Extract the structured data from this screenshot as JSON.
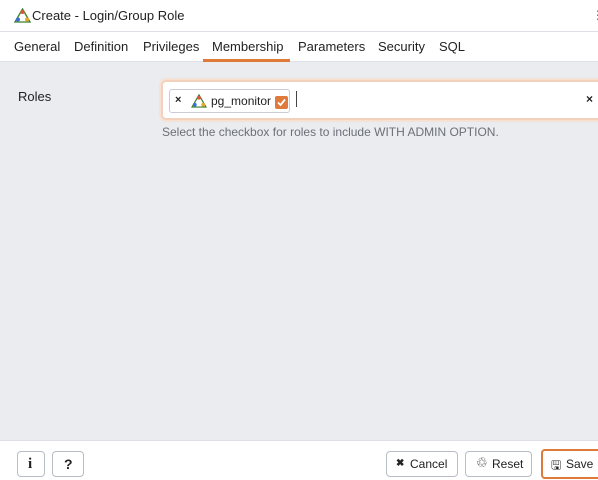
{
  "window": {
    "title": "Create - Login/Group Role",
    "title_icon": "login-group-role-icon",
    "overflow_glyph": "⋮"
  },
  "tabs": [
    {
      "label": "General"
    },
    {
      "label": "Definition"
    },
    {
      "label": "Privileges"
    },
    {
      "label": "Membership",
      "active": true
    },
    {
      "label": "Parameters"
    },
    {
      "label": "Security"
    },
    {
      "label": "SQL"
    }
  ],
  "membership": {
    "roles_label": "Roles",
    "selected_roles": [
      {
        "name": "pg_monitor",
        "admin_option": true,
        "remove_glyph": "×",
        "icon": "role-icon"
      }
    ],
    "clear_glyph": "×",
    "help_text": "Select the checkbox for roles to include WITH ADMIN OPTION."
  },
  "footer": {
    "info_glyph": "i",
    "help_glyph": "?",
    "cancel_glyph": "✖",
    "cancel_label": "Cancel",
    "reset_glyph": "♲",
    "reset_label": "Reset",
    "save_glyph": "🖫",
    "save_label": "Save"
  },
  "colors": {
    "accent": "#e07a3a",
    "content_background": "#ebecf0",
    "help_text": "#6b6f78"
  }
}
